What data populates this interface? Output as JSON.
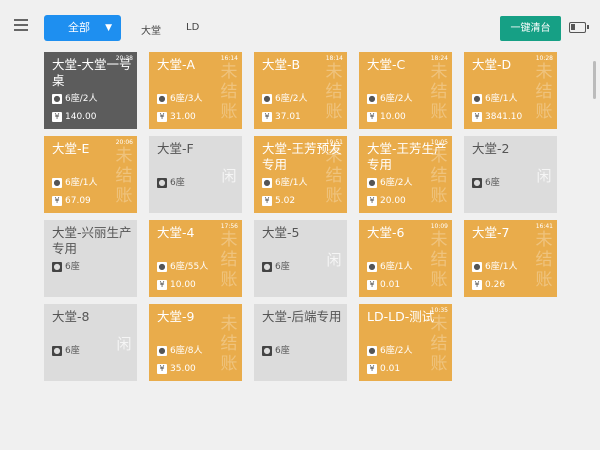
{
  "header": {
    "filter": "全部",
    "tabs": [
      "大堂",
      "LD"
    ],
    "clear_button": "一键清台",
    "battery_level": 0.3
  },
  "tables": [
    {
      "name": "大堂-大堂一号桌",
      "status": "selected",
      "time": "20:38",
      "seats": "6座/2人",
      "amount": "140.00",
      "watermark": ""
    },
    {
      "name": "大堂-A",
      "status": "occupied",
      "time": "16:14",
      "seats": "6座/3人",
      "amount": "31.00",
      "watermark": "未结账"
    },
    {
      "name": "大堂-B",
      "status": "occupied",
      "time": "18:14",
      "seats": "6座/2人",
      "amount": "37.01",
      "watermark": "未结账"
    },
    {
      "name": "大堂-C",
      "status": "occupied",
      "time": "18:24",
      "seats": "6座/2人",
      "amount": "10.00",
      "watermark": "未结账"
    },
    {
      "name": "大堂-D",
      "status": "occupied",
      "time": "10:28",
      "seats": "6座/1人",
      "amount": "3841.10",
      "watermark": "未结账"
    },
    {
      "name": "大堂-E",
      "status": "occupied",
      "time": "20:06",
      "seats": "6座/1人",
      "amount": "67.09",
      "watermark": "未结账"
    },
    {
      "name": "大堂-F",
      "status": "empty",
      "time": "",
      "seats": "6座",
      "amount": "",
      "watermark": "闲"
    },
    {
      "name": "大堂-王芳预发专用",
      "status": "occupied",
      "time": "19:51",
      "seats": "6座/1人",
      "amount": "5.02",
      "watermark": "未结账"
    },
    {
      "name": "大堂-王芳生产专用",
      "status": "occupied",
      "time": "10:05",
      "seats": "6座/2人",
      "amount": "20.00",
      "watermark": "未结账"
    },
    {
      "name": "大堂-2",
      "status": "empty",
      "time": "",
      "seats": "6座",
      "amount": "",
      "watermark": "闲"
    },
    {
      "name": "大堂-兴丽生产专用",
      "status": "empty",
      "time": "",
      "seats": "6座",
      "amount": "",
      "watermark": ""
    },
    {
      "name": "大堂-4",
      "status": "occupied",
      "time": "17:56",
      "seats": "6座/55人",
      "amount": "10.00",
      "watermark": "未结账"
    },
    {
      "name": "大堂-5",
      "status": "empty",
      "time": "",
      "seats": "6座",
      "amount": "",
      "watermark": "闲"
    },
    {
      "name": "大堂-6",
      "status": "occupied",
      "time": "10:09",
      "seats": "6座/1人",
      "amount": "0.01",
      "watermark": "未结账"
    },
    {
      "name": "大堂-7",
      "status": "occupied",
      "time": "16:41",
      "seats": "6座/1人",
      "amount": "0.26",
      "watermark": "未结账"
    },
    {
      "name": "大堂-8",
      "status": "empty",
      "time": "",
      "seats": "6座",
      "amount": "",
      "watermark": "闲"
    },
    {
      "name": "大堂-9",
      "status": "occupied",
      "time": "",
      "seats": "6座/8人",
      "amount": "35.00",
      "watermark": "未结账"
    },
    {
      "name": "大堂-后端专用",
      "status": "empty",
      "time": "",
      "seats": "6座",
      "amount": "",
      "watermark": ""
    },
    {
      "name": "LD-LD-测试",
      "status": "occupied",
      "time": "10:35",
      "seats": "6座/2人",
      "amount": "0.01",
      "watermark": "未结账"
    }
  ],
  "colors": {
    "occupied": "#e9ac4b",
    "selected": "#5c5c5c",
    "empty": "#dcdcdc",
    "accent": "#1e8ff0",
    "clear": "#16a085"
  },
  "icons": {
    "seats": "person-icon",
    "amount": "yen-icon"
  }
}
